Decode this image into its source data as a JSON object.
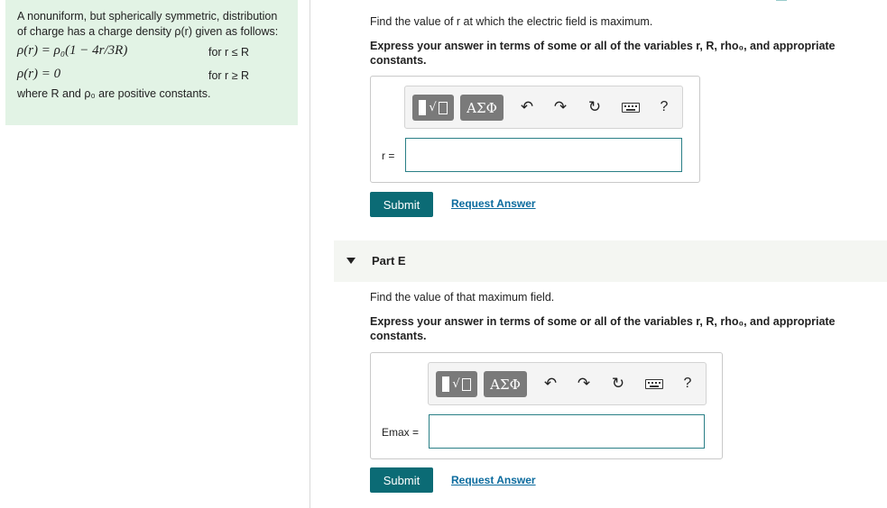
{
  "problem": {
    "intro": "A nonuniform, but spherically symmetric, distribution of charge has a charge density ρ(r) given as follows:",
    "eq1": "ρ(r) = ρ₀(1 − 4r/3R)",
    "eq1_cond": "for r ≤ R",
    "eq2": "ρ(r) = 0",
    "eq2_cond": "for r ≥ R",
    "where": "where R and ρ₀ are positive constants."
  },
  "partD": {
    "question": "Find the value of r at which the electric field is maximum.",
    "instructions": "Express your answer in terms of some or all of the variables r, R, rho₀, and appropriate constants.",
    "var_label": "r =",
    "input_value": "",
    "submit_label": "Submit",
    "request_label": "Request Answer"
  },
  "partE": {
    "title": "Part E",
    "question": "Find the value of that maximum field.",
    "instructions": "Express your answer in terms of some or all of the variables r, R, rho₀, and appropriate constants.",
    "var_label": "Emax =",
    "input_value": "",
    "submit_label": "Submit",
    "request_label": "Request Answer"
  },
  "toolbar": {
    "greek_label": "ΑΣΦ",
    "help_label": "?",
    "icons": [
      "template-icon",
      "greek-icon",
      "undo-icon",
      "redo-icon",
      "reset-icon",
      "keyboard-icon",
      "help-icon"
    ]
  }
}
